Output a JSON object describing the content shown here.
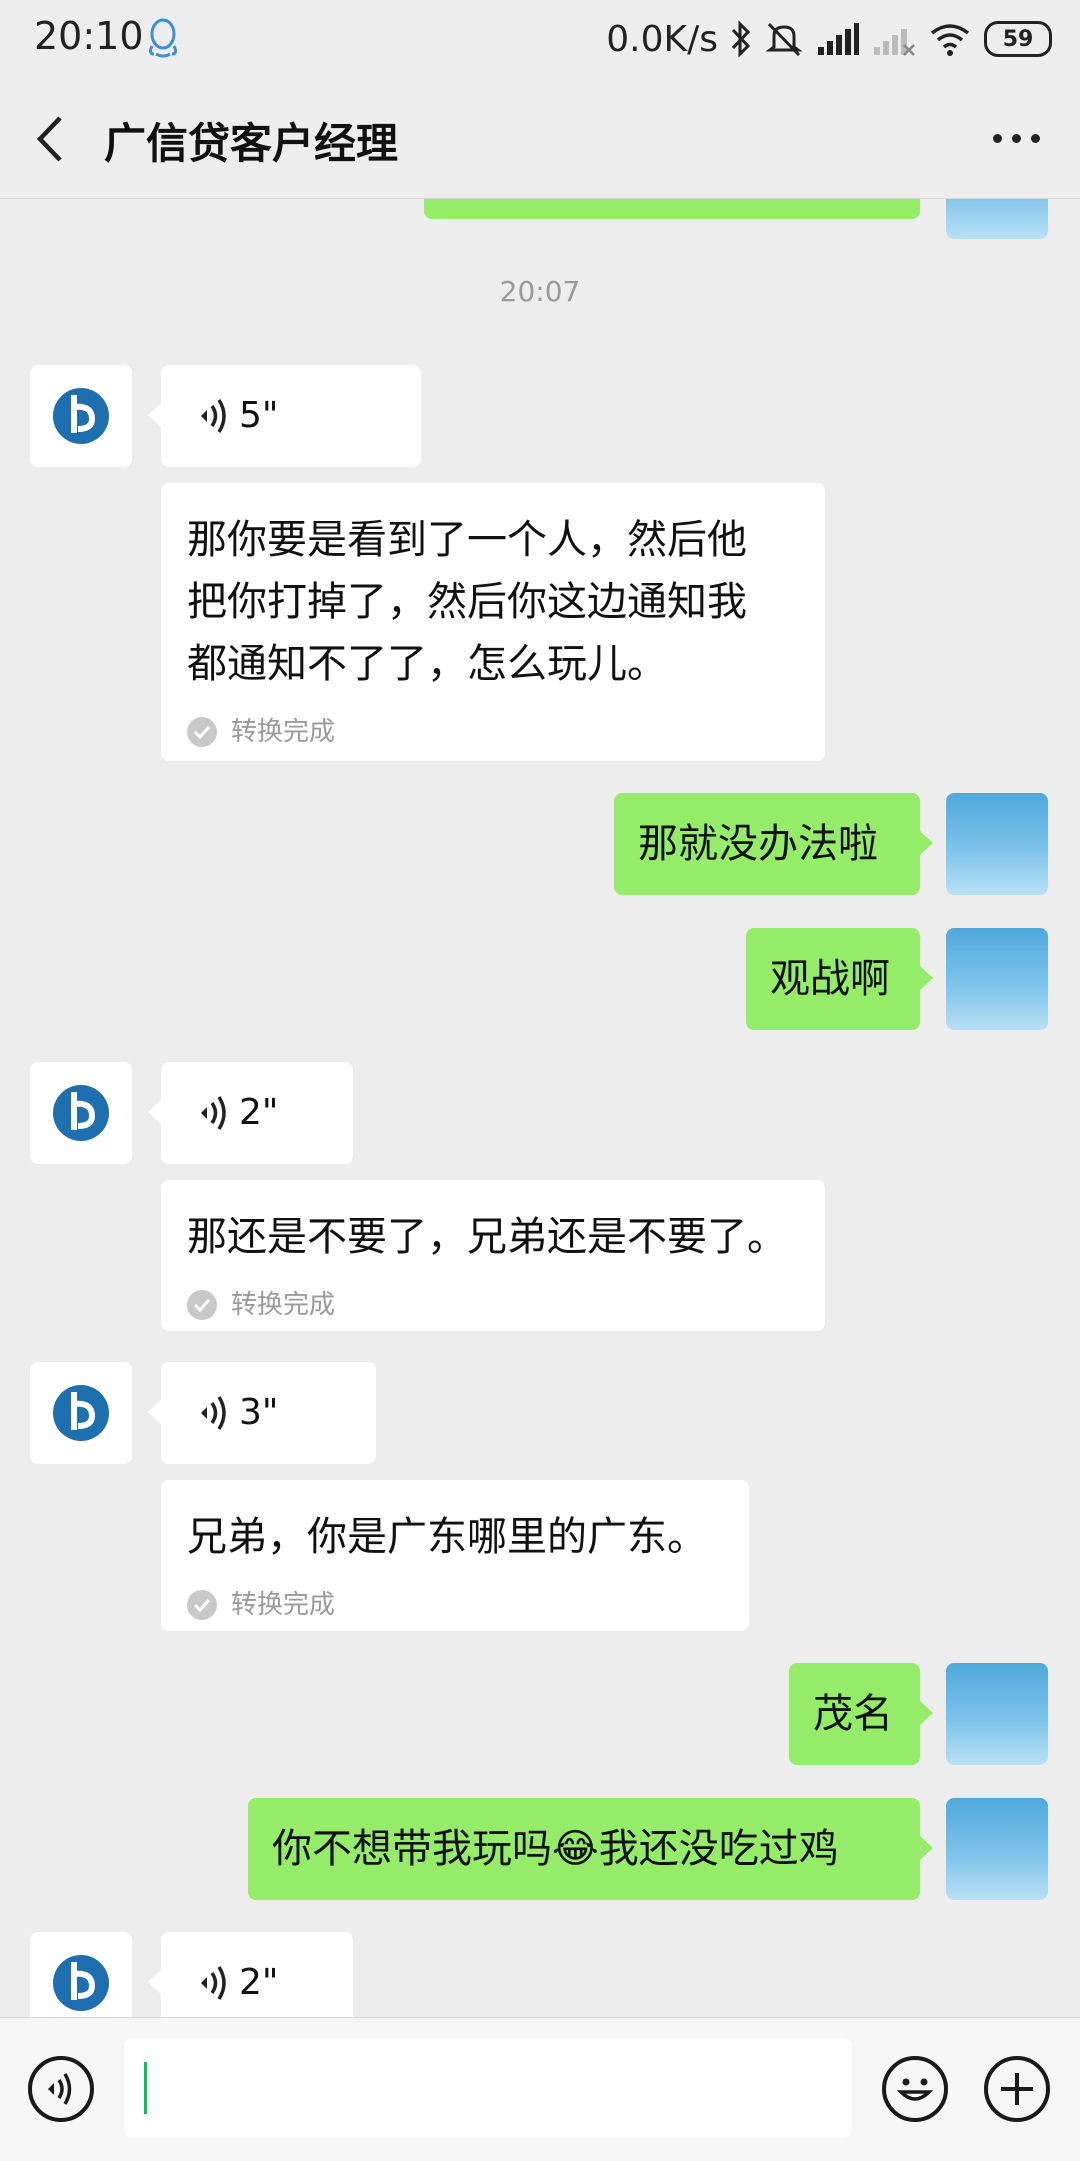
{
  "status_bar": {
    "time": "20:10",
    "network_speed": "0.0K/s",
    "battery": "59",
    "icons": [
      "qq-icon",
      "bluetooth-icon",
      "mute-icon",
      "signal-icon",
      "signal-weak-icon",
      "wifi-icon",
      "battery-icon"
    ]
  },
  "header": {
    "title": "广信贷客户经理",
    "back_icon": "chevron-left-icon",
    "more_icon": "more-icon"
  },
  "chat": {
    "timestamp": "20:07",
    "messages": [
      {
        "from": "them",
        "type": "voice",
        "duration": "5\"",
        "transcript": [
          "那你要是看到了一个人，然后他",
          "把你打掉了，然后你这边通知我",
          "都通知不了了，怎么玩儿。"
        ],
        "status": "转换完成"
      },
      {
        "from": "me",
        "type": "text",
        "text": "那就没办法啦"
      },
      {
        "from": "me",
        "type": "text",
        "text": "观战啊"
      },
      {
        "from": "them",
        "type": "voice",
        "duration": "2\"",
        "transcript": [
          "那还是不要了，兄弟还是不要了。"
        ],
        "status": "转换完成"
      },
      {
        "from": "them",
        "type": "voice",
        "duration": "3\"",
        "transcript": [
          "兄弟，你是广东哪里的广东。"
        ],
        "status": "转换完成"
      },
      {
        "from": "me",
        "type": "text",
        "text": "茂名"
      },
      {
        "from": "me",
        "type": "text",
        "text_before": "你不想带我玩吗",
        "emoji": "😂",
        "text_after": "我还没吃过鸡"
      },
      {
        "from": "them",
        "type": "voice",
        "duration": "2\""
      }
    ]
  },
  "input_bar": {
    "voice_icon": "voice-input-icon",
    "emoji_icon": "emoji-icon",
    "plus_icon": "plus-icon",
    "input_value": ""
  },
  "colors": {
    "background": "#ededed",
    "outgoing_bubble": "#95ec69",
    "incoming_bubble": "#ffffff",
    "caret": "#07c160",
    "avatar_brand": "#1e6fb0"
  }
}
